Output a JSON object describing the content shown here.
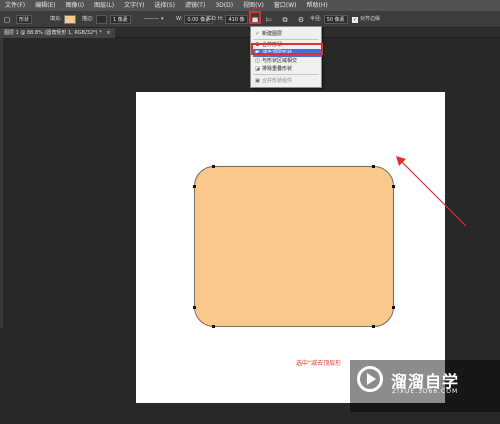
{
  "menu": [
    "文件(F)",
    "编辑(E)",
    "图像(I)",
    "图层(L)",
    "文字(Y)",
    "选择(S)",
    "滤镜(T)",
    "3D(D)",
    "视图(V)",
    "窗口(W)",
    "帮助(H)"
  ],
  "options": {
    "tool_mode": "形状",
    "fill_label": "填充:",
    "stroke_label": "描边:",
    "stroke_width": "1 像素",
    "w_label": "W:",
    "w_value": "0.00 像素",
    "link_label": "GO",
    "h_label": "H:",
    "h_value": "410 像",
    "radius_label": "半径:",
    "radius_value": "50 像素",
    "align_edges_label": "对齐边缘",
    "fill_color": "#f7c98c"
  },
  "tab": {
    "title": "图层 1 @ 88.8% (圆角矩形 1, RGB/32*) *",
    "close": "×"
  },
  "dropdown": {
    "items": [
      {
        "icon": "新建",
        "label": "新建图层",
        "checked": true
      },
      {
        "icon": "合并",
        "label": "合并形状"
      },
      {
        "icon": "减去",
        "label": "减去顶层形状",
        "selected": true
      },
      {
        "icon": "交叉",
        "label": "与形状区域相交"
      },
      {
        "icon": "排除",
        "label": "排除重叠形状"
      },
      {
        "icon": "",
        "label": "合并形状组件",
        "disabled": true
      }
    ]
  },
  "caption": "选中“减去顶层形",
  "shape_color": "#f9c98c",
  "highlight_color": "#e03030",
  "watermark": {
    "title": "溜溜自学",
    "url": "ZIXUE.3D66.COM"
  }
}
